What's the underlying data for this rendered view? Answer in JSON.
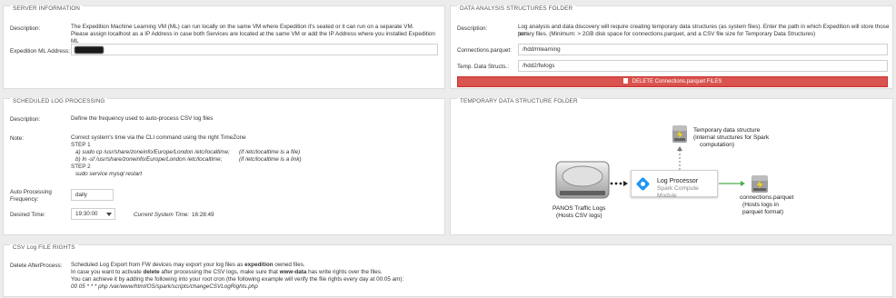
{
  "server": {
    "legend": "SERVER INFORMATION",
    "desc_label": "Description:",
    "desc_line1": "The Expedition Machine Learning VM (ML) can run locally on the same VM where Expedition it's seated or it can run on a separate VM.",
    "desc_line2": "Please assign localhost as a IP Address in case both Services are located at the same VM or add the IP Address where you installed Expedition ML",
    "ip_label": "Expedition ML Address:",
    "ip_value": ""
  },
  "dasf": {
    "legend": "DATA ANALYSIS STRUCTURES FOLDER",
    "desc_label": "Description:",
    "desc_line1": "Log analysis and data discovery will require creating temporary data structures (as system files). Enter the path in which Expedition will store those tem-",
    "desc_line2": "porary files. (Minimum: > 2GB disk space for connections.parquet, and a CSV file size for Temporary Data Structures)",
    "conn_label": "Connections.parquet:",
    "conn_value": "/hdd/mlearning",
    "temp_label": "Temp. Data Structs.:",
    "temp_value": "/hdd2/fwlogs",
    "delete_label": "DELETE Connections.parquet FILES"
  },
  "sched": {
    "legend": "SCHEDULED LOG PROCESSING",
    "desc_label": "Description:",
    "desc_text": "Define the frequency used to auto-process CSV log files",
    "note_label": "Note:",
    "note_line1": "Correct system's time via the CLI command using the right TimeZone",
    "step1": "STEP 1",
    "step1a_cmd": "a) sudo cp /usr/share/zoneinfo/Europe/London /etc/localtime;",
    "step1a_note": "(if /etc/localtime is a file)",
    "step1b_cmd": "b) ln -sf /usr/share/zoneinfo/Europe/London /etc/localtime;",
    "step1b_note": "(if /etc/localtime is a link)",
    "step2": "STEP 2",
    "step2_cmd": "sudo service mysql restart",
    "freq_label_1": "Auto Processing",
    "freq_label_2": "Frequency:",
    "freq_value": "daily",
    "time_label": "Desired Time:",
    "time_value": "19:30:00",
    "sys_time_label": "Current System Time:",
    "sys_time_value": "16:28:49"
  },
  "tdsf": {
    "legend": "TEMPORARY DATA STRUCTURE FOLDER",
    "tds_label_1": "Temporary data structure",
    "tds_label_2": "(internal structures for Spark",
    "tds_label_3": "computation)",
    "proc_title": "Log Processor",
    "proc_sub": "Spark Compute Module",
    "panos_1": "PANOS Traffic Logs",
    "panos_2": "(Hosts CSV logs)",
    "parquet_1": "connections.parquet",
    "parquet_2": "(Hosts logs in",
    "parquet_3": "parquet format)"
  },
  "csv": {
    "legend": "CSV Log FILE RIGHTS",
    "label": "Delete AfterProcess:",
    "l1_pre": "Scheduled Log Export from FW devices may export your log files as ",
    "l1_bold": "expedition",
    "l1_post": " owned files.",
    "l2_pre": "In case you want to activate ",
    "l2_bold1": "delete",
    "l2_mid": " after processing the CSV logs, make sure that ",
    "l2_bold2": "www-data",
    "l2_post": " has write rights over the files.",
    "l3": "You can achieve it by adding the following into your root cron (the following example will verify the file rights every day at 00:05 am):",
    "l4": "00 05 * * * php /var/www/html/OS/spark/scripts/changeCSVLogRights.php"
  },
  "colors": {
    "accent_red": "#d9534f",
    "spark_green": "#4caf50",
    "panel_border": "#dcdcdc"
  }
}
